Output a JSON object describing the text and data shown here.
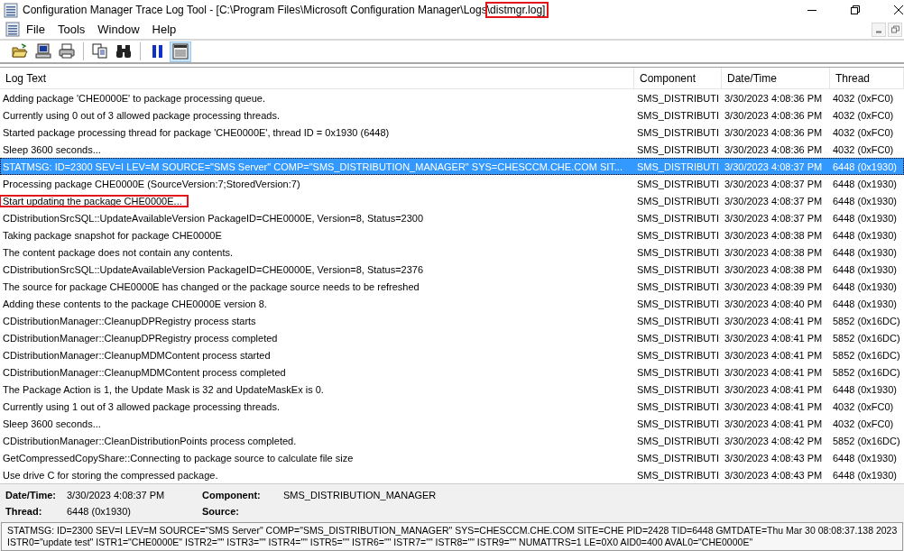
{
  "window": {
    "title_parts": [
      {
        "text": "Configuration Manager Trace Log Tool - [C:\\Program Files\\Microsoft Configuration Manager\\Logs",
        "marked": false
      },
      {
        "text": "\\distmgr.log]",
        "marked": true
      }
    ]
  },
  "menu": [
    "File",
    "Tools",
    "Window",
    "Help"
  ],
  "toolbar": [
    {
      "kind": "open",
      "pressed": false
    },
    {
      "kind": "computer",
      "pressed": false
    },
    {
      "kind": "print",
      "pressed": false
    },
    {
      "kind": "separator"
    },
    {
      "kind": "copy",
      "pressed": false
    },
    {
      "kind": "find",
      "pressed": false
    },
    {
      "kind": "separator"
    },
    {
      "kind": "pause",
      "pressed": false
    },
    {
      "kind": "details",
      "pressed": true
    }
  ],
  "table": {
    "columns": [
      "Log Text",
      "Component",
      "Date/Time",
      "Thread"
    ],
    "rows": [
      {
        "text": "Adding package 'CHE0000E' to package processing queue.",
        "component": "SMS_DISTRIBUTI",
        "time": "3/30/2023 4:08:36 PM",
        "thread": "4032 (0xFC0)",
        "selected": false,
        "marked": false
      },
      {
        "text": "Currently using 0 out of 3 allowed package processing threads.",
        "component": "SMS_DISTRIBUTI",
        "time": "3/30/2023 4:08:36 PM",
        "thread": "4032 (0xFC0)",
        "selected": false,
        "marked": false
      },
      {
        "text": "Started package processing thread for package 'CHE0000E', thread ID = 0x1930 (6448)",
        "component": "SMS_DISTRIBUTI",
        "time": "3/30/2023 4:08:36 PM",
        "thread": "4032 (0xFC0)",
        "selected": false,
        "marked": false
      },
      {
        "text": "Sleep 3600 seconds...",
        "component": "SMS_DISTRIBUTI",
        "time": "3/30/2023 4:08:36 PM",
        "thread": "4032 (0xFC0)",
        "selected": false,
        "marked": false
      },
      {
        "text": "STATMSG: ID=2300 SEV=I LEV=M SOURCE=\"SMS Server\" COMP=\"SMS_DISTRIBUTION_MANAGER\" SYS=CHESCCM.CHE.COM SIT...",
        "component": "SMS_DISTRIBUTI",
        "time": "3/30/2023 4:08:37 PM",
        "thread": "6448 (0x1930)",
        "selected": true,
        "marked": false
      },
      {
        "text": "Processing package CHE0000E (SourceVersion:7;StoredVersion:7)",
        "component": "SMS_DISTRIBUTI",
        "time": "3/30/2023 4:08:37 PM",
        "thread": "6448 (0x1930)",
        "selected": false,
        "marked": false
      },
      {
        "text": "Start updating the package CHE0000E...",
        "component": "SMS_DISTRIBUTI",
        "time": "3/30/2023 4:08:37 PM",
        "thread": "6448 (0x1930)",
        "selected": false,
        "marked": true
      },
      {
        "text": "CDistributionSrcSQL::UpdateAvailableVersion PackageID=CHE0000E, Version=8, Status=2300",
        "component": "SMS_DISTRIBUTI",
        "time": "3/30/2023 4:08:37 PM",
        "thread": "6448 (0x1930)",
        "selected": false,
        "marked": false
      },
      {
        "text": "Taking package snapshot for package CHE0000E",
        "component": "SMS_DISTRIBUTI",
        "time": "3/30/2023 4:08:38 PM",
        "thread": "6448 (0x1930)",
        "selected": false,
        "marked": false
      },
      {
        "text": "The content package does not contain any contents.",
        "component": "SMS_DISTRIBUTI",
        "time": "3/30/2023 4:08:38 PM",
        "thread": "6448 (0x1930)",
        "selected": false,
        "marked": false
      },
      {
        "text": "CDistributionSrcSQL::UpdateAvailableVersion PackageID=CHE0000E, Version=8, Status=2376",
        "component": "SMS_DISTRIBUTI",
        "time": "3/30/2023 4:08:38 PM",
        "thread": "6448 (0x1930)",
        "selected": false,
        "marked": false
      },
      {
        "text": "The source for package CHE0000E has changed or the package source needs to be refreshed",
        "component": "SMS_DISTRIBUTI",
        "time": "3/30/2023 4:08:39 PM",
        "thread": "6448 (0x1930)",
        "selected": false,
        "marked": false
      },
      {
        "text": "Adding these contents to the package CHE0000E version 8.",
        "component": "SMS_DISTRIBUTI",
        "time": "3/30/2023 4:08:40 PM",
        "thread": "6448 (0x1930)",
        "selected": false,
        "marked": false
      },
      {
        "text": "CDistributionManager::CleanupDPRegistry process starts",
        "component": "SMS_DISTRIBUTI",
        "time": "3/30/2023 4:08:41 PM",
        "thread": "5852 (0x16DC)",
        "selected": false,
        "marked": false
      },
      {
        "text": "CDistributionManager::CleanupDPRegistry process completed",
        "component": "SMS_DISTRIBUTI",
        "time": "3/30/2023 4:08:41 PM",
        "thread": "5852 (0x16DC)",
        "selected": false,
        "marked": false
      },
      {
        "text": "CDistributionManager::CleanupMDMContent process started",
        "component": "SMS_DISTRIBUTI",
        "time": "3/30/2023 4:08:41 PM",
        "thread": "5852 (0x16DC)",
        "selected": false,
        "marked": false
      },
      {
        "text": "CDistributionManager::CleanupMDMContent process completed",
        "component": "SMS_DISTRIBUTI",
        "time": "3/30/2023 4:08:41 PM",
        "thread": "5852 (0x16DC)",
        "selected": false,
        "marked": false
      },
      {
        "text": "The Package Action is 1, the Update Mask is 32 and UpdateMaskEx is 0.",
        "component": "SMS_DISTRIBUTI",
        "time": "3/30/2023 4:08:41 PM",
        "thread": "6448 (0x1930)",
        "selected": false,
        "marked": false
      },
      {
        "text": "Currently using 1 out of 3 allowed package processing threads.",
        "component": "SMS_DISTRIBUTI",
        "time": "3/30/2023 4:08:41 PM",
        "thread": "4032 (0xFC0)",
        "selected": false,
        "marked": false
      },
      {
        "text": "Sleep 3600 seconds...",
        "component": "SMS_DISTRIBUTI",
        "time": "3/30/2023 4:08:41 PM",
        "thread": "4032 (0xFC0)",
        "selected": false,
        "marked": false
      },
      {
        "text": "CDistributionManager::CleanDistributionPoints process completed.",
        "component": "SMS_DISTRIBUTI",
        "time": "3/30/2023 4:08:42 PM",
        "thread": "5852 (0x16DC)",
        "selected": false,
        "marked": false
      },
      {
        "text": "GetCompressedCopyShare::Connecting to package source to calculate file size",
        "component": "SMS_DISTRIBUTI",
        "time": "3/30/2023 4:08:43 PM",
        "thread": "6448 (0x1930)",
        "selected": false,
        "marked": false
      },
      {
        "text": "Use drive C for storing the compressed package.",
        "component": "SMS_DISTRIBUTI",
        "time": "3/30/2023 4:08:43 PM",
        "thread": "6448 (0x1930)",
        "selected": false,
        "marked": false
      }
    ]
  },
  "details": {
    "fields": [
      {
        "label": "Date/Time:",
        "value": "3/30/2023 4:08:37 PM"
      },
      {
        "label": "Component:",
        "value": "SMS_DISTRIBUTION_MANAGER"
      },
      {
        "label": "Thread:",
        "value": "6448 (0x1930)"
      },
      {
        "label": "Source:"
      }
    ],
    "message_lines": [
      "STATMSG: ID=2300 SEV=I LEV=M SOURCE=\"SMS Server\" COMP=\"SMS_DISTRIBUTION_MANAGER\" SYS=CHESCCM.CHE.COM SITE=CHE PID=2428 TID=6448 GMTDATE=Thu Mar 30 08:08:37.138 2023",
      "ISTR0=\"update test\" ISTR1=\"CHE0000E\" ISTR2=\"\" ISTR3=\"\" ISTR4=\"\" ISTR5=\"\" ISTR6=\"\" ISTR7=\"\" ISTR8=\"\" ISTR9=\"\" NUMATTRS=1 LE=0X0 AID0=400 AVAL0=\"CHE0000E\""
    ]
  }
}
